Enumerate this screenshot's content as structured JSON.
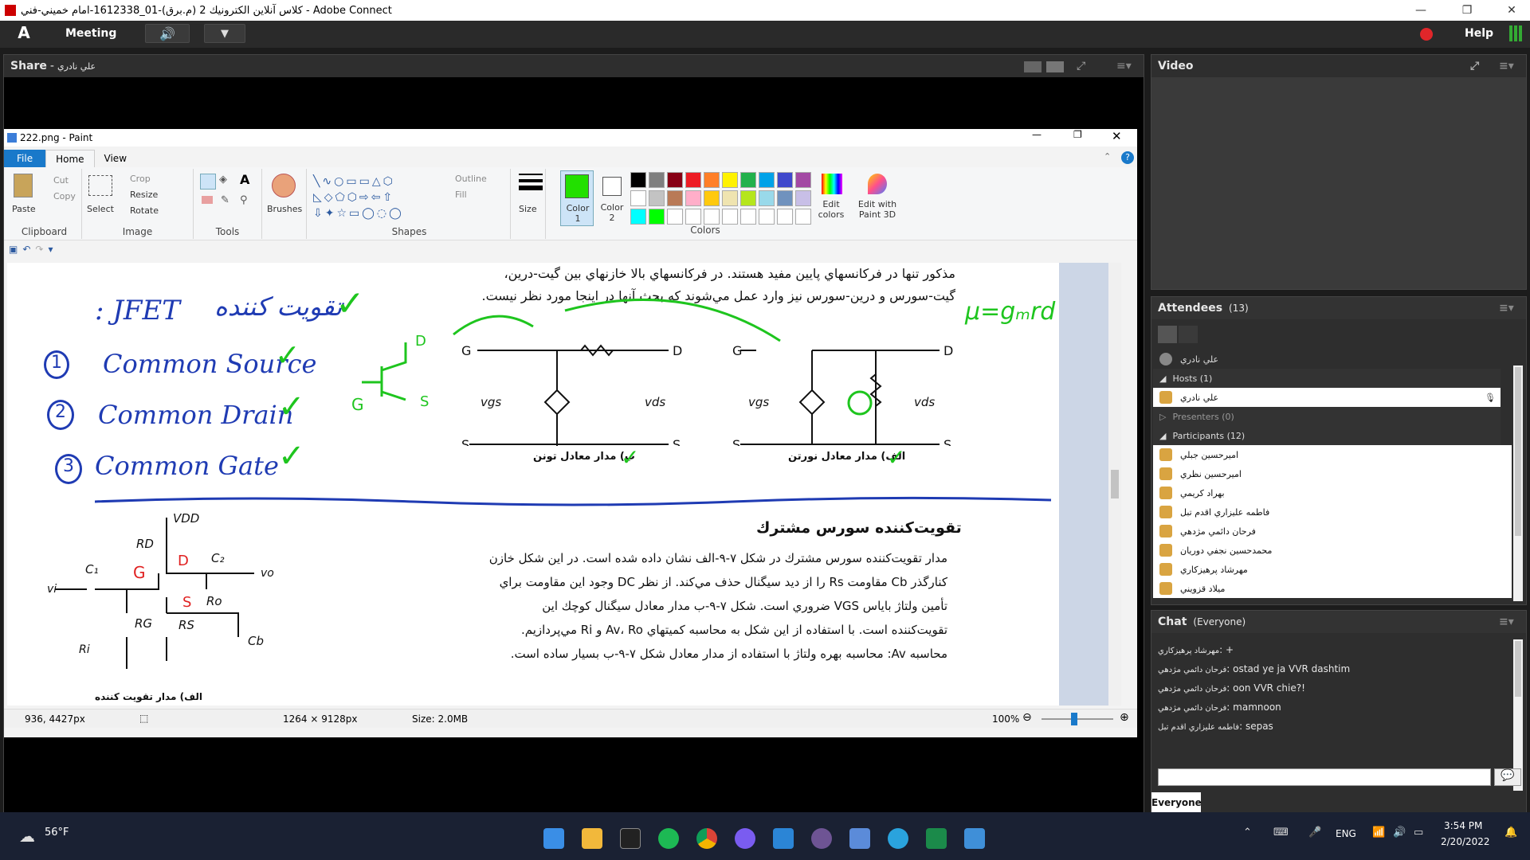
{
  "window": {
    "title": "كلاس آنلاين الكترونيك 2 (م.برق)-01_1612338-امام خميني-فني - Adobe Connect"
  },
  "topbar": {
    "meeting_label": "Meeting",
    "help_label": "Help"
  },
  "share_pod": {
    "title": "Share",
    "presenter": "علي نادري"
  },
  "video_pod": {
    "title": "Video"
  },
  "paint": {
    "title": "222.png - Paint",
    "tabs": [
      "File",
      "Home",
      "View"
    ],
    "clipboard": {
      "paste": "Paste",
      "cut": "Cut",
      "copy": "Copy",
      "label": "Clipboard"
    },
    "image": {
      "select": "Select",
      "crop": "Crop",
      "resize": "Resize",
      "rotate": "Rotate",
      "label": "Image"
    },
    "tools": {
      "label": "Tools"
    },
    "brushes": "Brushes",
    "shapes": {
      "outline": "Outline",
      "fill": "Fill",
      "label": "Shapes"
    },
    "size": "Size",
    "color1": "Color 1",
    "color2": "Color 2",
    "colors_label": "Colors",
    "edit_colors": "Edit colors",
    "edit3d": "Edit with Paint 3D",
    "palette": [
      "#000000",
      "#7f7f7f",
      "#880015",
      "#ed1c24",
      "#ff7f27",
      "#fff200",
      "#22b14c",
      "#00a2e8",
      "#3f48cc",
      "#a349a4",
      "#ffffff",
      "#c3c3c3",
      "#b97a57",
      "#ffaec9",
      "#ffc90e",
      "#efe4b0",
      "#b5e61d",
      "#99d9ea",
      "#7092be",
      "#c8bfe7",
      "#00ffff",
      "#00ff00"
    ],
    "status": {
      "cursor": "936, 4427px",
      "dimensions": "1264 × 9128px",
      "size": "Size: 2.0MB",
      "zoom": "100%"
    },
    "zoom_level": 0.45
  },
  "canvas": {
    "handwritten": {
      "jfet": ": JFET",
      "amplifier_fa": "تقويت كننده",
      "item1_num": "1",
      "item1": "Common Source",
      "item2_num": "2",
      "item2": "Common Drain",
      "item3_num": "3",
      "item3": "Common Gate",
      "mu": "μ=gₘrd"
    },
    "text_top_line1": "مذكور تنها در فركانسهاي پايين مفيد هستند. در فركانسهاي بالا خازنهاي بين گيت-درين،",
    "text_top_line2": "گيت-سورس و درين-سورس نيز وارد عمل مي‌شوند كه بحث آنها در اينجا مورد نظر نيست.",
    "caption_thevenin": "ب) مدار معادل تونن",
    "caption_norton": "الف) مدار معادل نورتن",
    "section_heading": "تقويت‌كننده سورس مشترك",
    "para_lines": [
      "مدار تقويت‌كننده سورس مشترك در شكل ۷-۹-الف نشان داده شده است. در اين شكل خازن",
      "كنارگذر Cb مقاومت Rs را از ديد سيگنال حذف مي‌كند. از نظر DC وجود اين مقاومت براي",
      "تأمين ولتاژ باياس VGS ضروري است. شكل ۷-۹-ب مدار معادل سيگنال كوچك اين",
      "تقويت‌كننده است. با استفاده از اين شكل به محاسبه كميتهاي Av، Ro و Ri مي‌پردازيم.",
      "محاسبه Av: محاسبه بهره ولتاژ با استفاده از مدار معادل شكل ۷-۹-ب بسيار ساده است."
    ],
    "caption_amp": "الف) مدار تقويت كننده"
  },
  "attendees": {
    "title": "Attendees",
    "count": "(13)",
    "me": "علي نادري",
    "hosts_label": "Hosts (1)",
    "host": "علي نادري",
    "presenters_label": "Presenters (0)",
    "participants_label": "Participants (12)",
    "participants": [
      "اميرحسين جبلي",
      "اميرحسين نظري",
      "بهراد كريمي",
      "فاطمه عليزاري اقدم تبل",
      "فرحان دائمي مژدهي",
      "محمدحسين نجفي دوريان",
      "مهرشاد پرهيزكاري",
      "ميلاد قزويني"
    ]
  },
  "chat": {
    "title": "Chat",
    "scope": "(Everyone)",
    "messages": [
      {
        "from": "مهرشاد پرهيزكاري",
        "text": "+"
      },
      {
        "from": "فرحان دائمي مژدهي",
        "text": "ostad ye ja VVR dashtim"
      },
      {
        "from": "فرحان دائمي مژدهي",
        "text": "oon VVR chie?!"
      },
      {
        "from": "فرحان دائمي مژدهي",
        "text": "mamnoon"
      },
      {
        "from": "فاطمه عليزاري اقدم تبل",
        "text": "sepas"
      }
    ],
    "tab": "Everyone",
    "input_placeholder": ""
  },
  "taskbar": {
    "weather": "56°F",
    "lang": "ENG",
    "time": "3:54 PM",
    "date": "2/20/2022"
  }
}
